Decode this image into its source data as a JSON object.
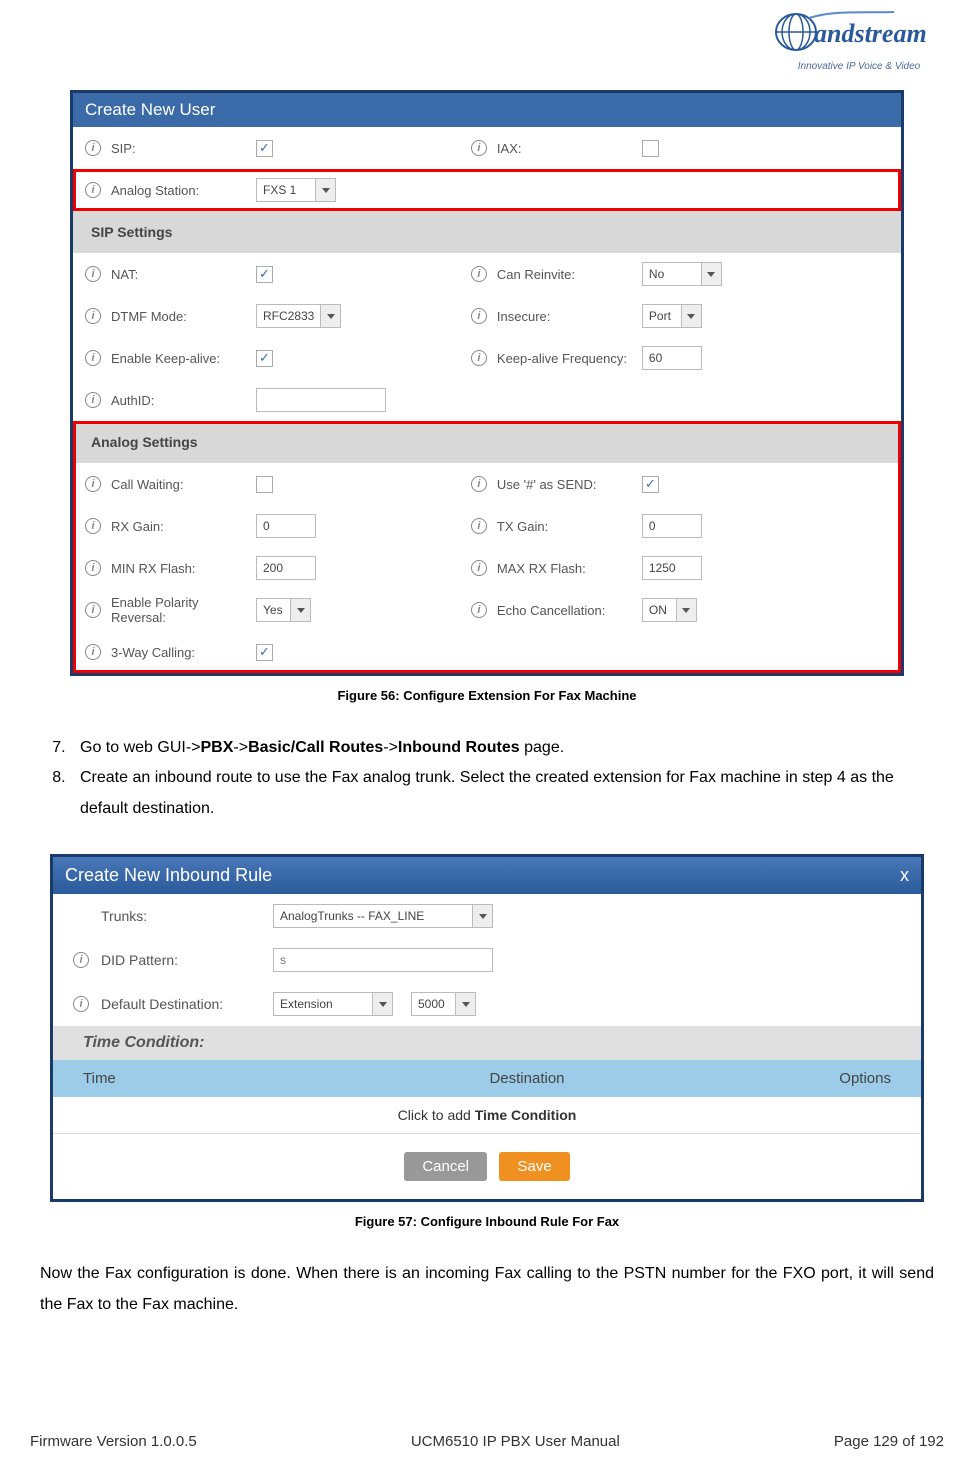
{
  "logo": {
    "brand": "Grandstream",
    "tagline": "Innovative IP Voice & Video"
  },
  "fig1": {
    "title": "Create New User",
    "caption": "Figure 56: Configure Extension For Fax Machine",
    "rows": {
      "sip_lbl": "SIP:",
      "sip_chk": "✓",
      "iax_lbl": "IAX:",
      "iax_chk": "",
      "analog_station_lbl": "Analog Station:",
      "analog_station_val": "FXS 1",
      "sip_settings_hdr": "SIP Settings",
      "nat_lbl": "NAT:",
      "nat_chk": "✓",
      "can_reinvite_lbl": "Can Reinvite:",
      "can_reinvite_val": "No",
      "dtmf_lbl": "DTMF Mode:",
      "dtmf_val": "RFC2833",
      "insecure_lbl": "Insecure:",
      "insecure_val": "Port",
      "keepalive_lbl": "Enable Keep-alive:",
      "keepalive_chk": "✓",
      "keepalive_freq_lbl": "Keep-alive Frequency:",
      "keepalive_freq_val": "60",
      "authid_lbl": "AuthID:",
      "authid_val": "",
      "analog_settings_hdr": "Analog Settings",
      "call_waiting_lbl": "Call Waiting:",
      "call_waiting_chk": "",
      "use_hash_lbl": "Use '#' as SEND:",
      "use_hash_chk": "✓",
      "rx_gain_lbl": "RX Gain:",
      "rx_gain_val": "0",
      "tx_gain_lbl": "TX Gain:",
      "tx_gain_val": "0",
      "min_rx_lbl": "MIN RX Flash:",
      "min_rx_val": "200",
      "max_rx_lbl": "MAX RX Flash:",
      "max_rx_val": "1250",
      "polarity_lbl": "Enable Polarity Reversal:",
      "polarity_val": "Yes",
      "echo_lbl": "Echo Cancellation:",
      "echo_val": "ON",
      "threeway_lbl": "3-Way Calling:",
      "threeway_chk": "✓"
    }
  },
  "steps": {
    "s7_pre": "Go to web GUI->",
    "s7_b1": "PBX",
    "s7_mid1": "->",
    "s7_b2": "Basic/Call Routes",
    "s7_mid2": "->",
    "s7_b3": "Inbound Routes",
    "s7_post": " page.",
    "s8": "Create an inbound route to use the Fax analog trunk. Select the created extension for Fax machine in step 4 as the default destination."
  },
  "fig2": {
    "title": "Create New Inbound Rule",
    "caption": "Figure 57: Configure Inbound Rule For Fax",
    "trunks_lbl": "Trunks:",
    "trunks_val": "AnalogTrunks -- FAX_LINE",
    "did_lbl": "DID Pattern:",
    "did_placeholder": "s",
    "dest_lbl": "Default Destination:",
    "dest_type": "Extension",
    "dest_ext": "5000",
    "tc_hdr": "Time Condition:",
    "tc_time": "Time",
    "tc_dest": "Destination",
    "tc_opts": "Options",
    "tc_add_pre": "Click to add ",
    "tc_add_bold": "Time Condition",
    "cancel": "Cancel",
    "save": "Save"
  },
  "conclusion": "Now the Fax configuration is done. When there is an incoming Fax calling to the PSTN number for the FXO port, it will send the Fax to the Fax machine.",
  "footer": {
    "left": "Firmware Version 1.0.0.5",
    "center": "UCM6510 IP PBX User Manual",
    "right": "Page 129 of 192"
  }
}
